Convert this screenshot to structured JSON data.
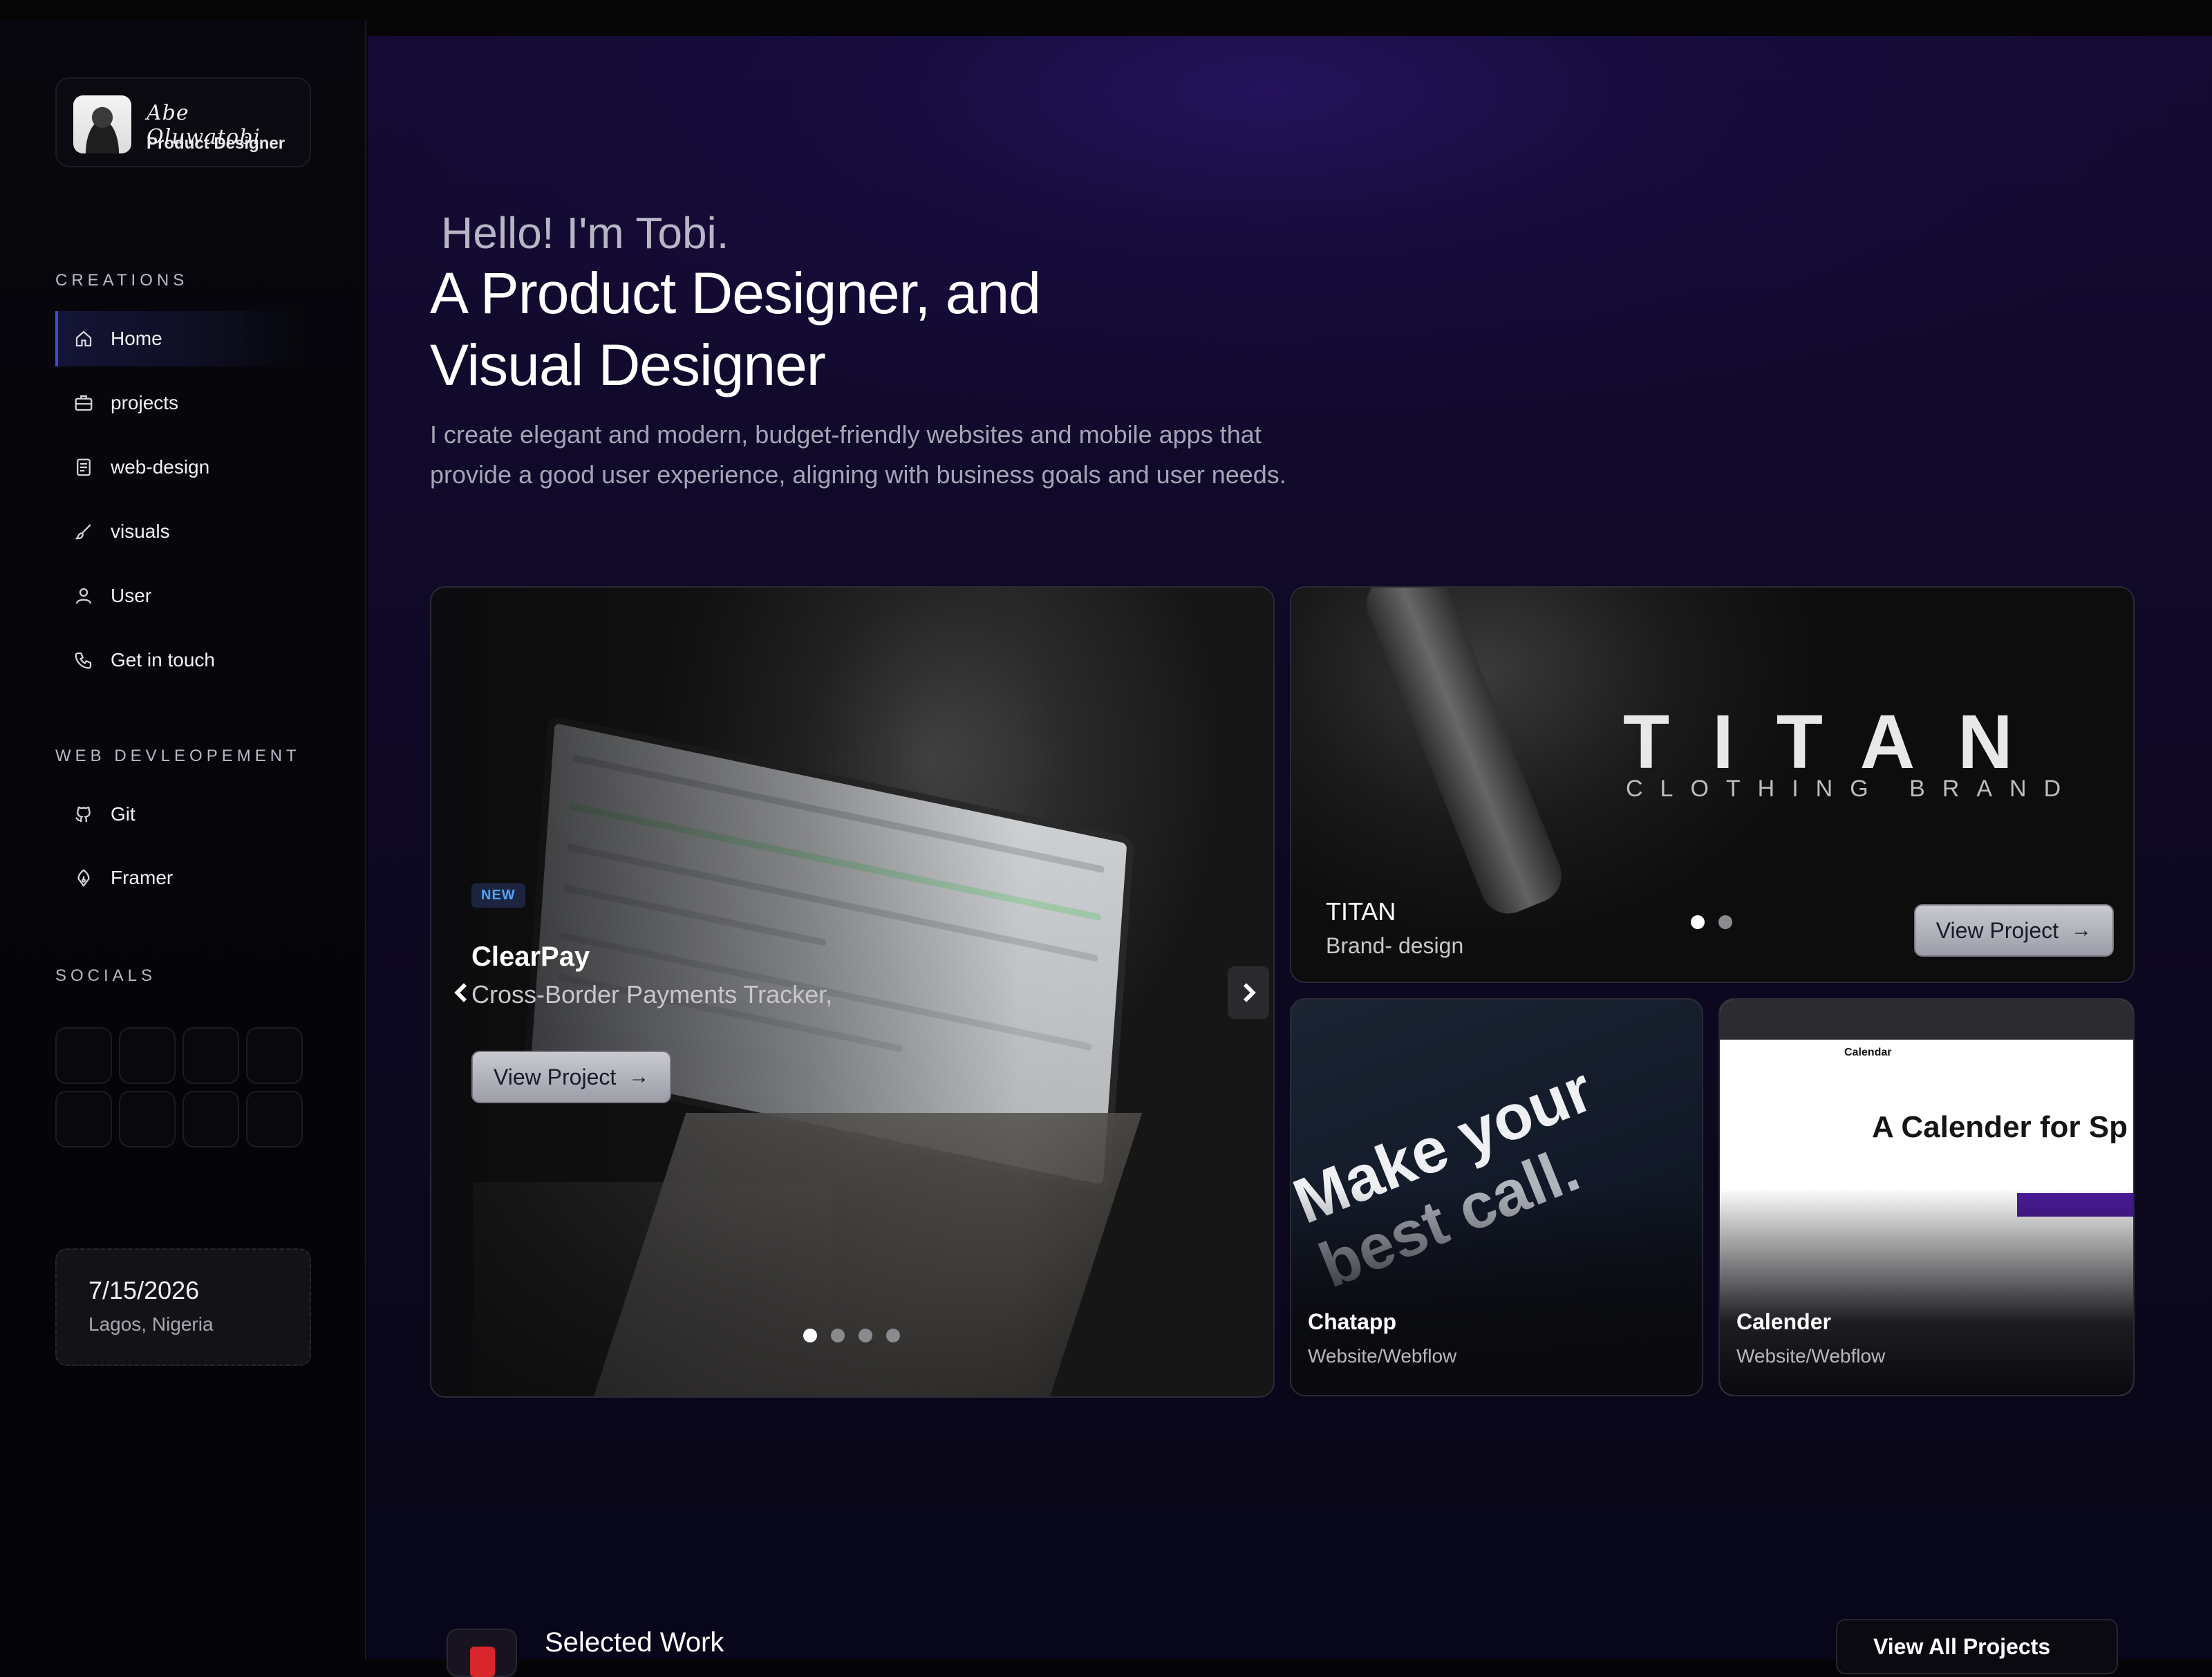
{
  "profile": {
    "name": "Abe Oluwatobi",
    "role": "Product Designer"
  },
  "sidebar": {
    "creations_label": "CREATIONS",
    "creations": [
      {
        "label": "Home",
        "icon": "home-icon",
        "active": true
      },
      {
        "label": "projects",
        "icon": "briefcase-icon"
      },
      {
        "label": "web-design",
        "icon": "document-icon"
      },
      {
        "label": "visuals",
        "icon": "brush-icon"
      },
      {
        "label": "User",
        "icon": "user-icon"
      },
      {
        "label": "Get in touch",
        "icon": "phone-icon"
      }
    ],
    "webdev_label": "WEB DEVLEOPEMENT",
    "webdev": [
      {
        "label": "Git",
        "icon": "github-icon"
      },
      {
        "label": "Framer",
        "icon": "framer-icon"
      }
    ],
    "socials_label": "SOCIALS",
    "date": "7/15/2026",
    "location": "Lagos, Nigeria"
  },
  "hero": {
    "hello": "Hello! I'm Tobi.",
    "headline_line1": "A Product Designer, and",
    "headline_line2": "Visual Designer",
    "intro_line1": "I create elegant and modern, budget-friendly websites and mobile apps that",
    "intro_line2": "provide a good user experience, aligning with business goals and user needs."
  },
  "featured": {
    "badge": "NEW",
    "title": "ClearPay",
    "subtitle": "Cross-Border Payments Tracker,",
    "button": "View Project",
    "slides": 4,
    "active_slide": 1
  },
  "titan": {
    "big": "TITAN",
    "small": "CLOTHING BRAND",
    "name": "TITAN",
    "sub": "Brand- design",
    "button": "View Project",
    "slides": 2,
    "active_slide": 1
  },
  "chatapp": {
    "art_line1": "Make your",
    "art_line2": "best call.",
    "title": "Chatapp",
    "sub": "Website/Webflow"
  },
  "calendar": {
    "logo": "Calendar",
    "headline": "A Calender for Sp",
    "title": "Calender",
    "sub": "Website/Webflow"
  },
  "selected": {
    "title": "Selected Work",
    "button": "View All Projects"
  },
  "colors": {
    "accent": "#3d4bd6",
    "badge_text": "#4ea6ff",
    "background": "#0e0823"
  }
}
